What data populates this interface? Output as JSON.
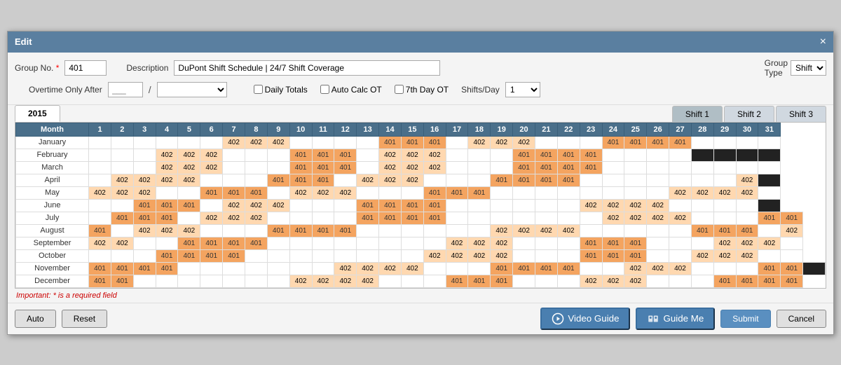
{
  "dialog": {
    "title": "Edit",
    "close_label": "×"
  },
  "form": {
    "group_no_label": "Group No.",
    "group_no_value": "401",
    "description_label": "Description",
    "description_value": "DuPont Shift Schedule | 24/7 Shift Coverage",
    "overtime_label": "Overtime Only After",
    "overtime_value": "",
    "overtime_placeholder": "___",
    "daily_totals_label": "Daily Totals",
    "auto_calc_label": "Auto Calc OT",
    "seventh_day_label": "7th Day OT",
    "shifts_day_label": "Shifts/Day",
    "shifts_day_value": "1",
    "group_type_label": "Group Type",
    "group_type_value": "Shift"
  },
  "tabs": {
    "year_tab": "2015",
    "shift_tabs": [
      "Shift 1",
      "Shift 2",
      "Shift 3"
    ]
  },
  "calendar": {
    "header": [
      "Month",
      "1",
      "2",
      "3",
      "4",
      "5",
      "6",
      "7",
      "8",
      "9",
      "10",
      "11",
      "12",
      "13",
      "14",
      "15",
      "16",
      "17",
      "18",
      "19",
      "20",
      "21",
      "22",
      "23",
      "24",
      "25",
      "26",
      "27",
      "28",
      "29",
      "30",
      "31"
    ],
    "rows": [
      {
        "month": "January",
        "cells": [
          "",
          "",
          "",
          "",
          "",
          "",
          "402",
          "402",
          "402",
          "",
          "",
          "",
          "",
          "401",
          "401",
          "401",
          "",
          "402",
          "402",
          "402",
          "",
          "",
          "",
          "401",
          "401",
          "401",
          "401",
          "",
          "",
          "",
          ""
        ]
      },
      {
        "month": "February",
        "cells": [
          "",
          "",
          "",
          "402",
          "402",
          "402",
          "",
          "",
          "",
          "401",
          "401",
          "401",
          "",
          "402",
          "402",
          "402",
          "",
          "",
          "",
          "401",
          "401",
          "401",
          "401",
          "",
          "",
          "",
          "",
          "black",
          "black",
          "black",
          "black"
        ]
      },
      {
        "month": "March",
        "cells": [
          "",
          "",
          "",
          "402",
          "402",
          "402",
          "",
          "",
          "",
          "401",
          "401",
          "401",
          "",
          "402",
          "402",
          "402",
          "",
          "",
          "",
          "401",
          "401",
          "401",
          "401",
          "",
          "",
          "",
          "",
          "",
          "",
          "",
          ""
        ]
      },
      {
        "month": "April",
        "cells": [
          "",
          "402",
          "402",
          "402",
          "402",
          "",
          "",
          "",
          "401",
          "401",
          "401",
          "",
          "402",
          "402",
          "402",
          "",
          "",
          "",
          "401",
          "401",
          "401",
          "401",
          "",
          "",
          "",
          "",
          "",
          "",
          "",
          "402",
          "black"
        ]
      },
      {
        "month": "May",
        "cells": [
          "402",
          "402",
          "402",
          "",
          "",
          "401",
          "401",
          "401",
          "",
          "402",
          "402",
          "402",
          "",
          "",
          "",
          "401",
          "401",
          "401",
          "",
          "",
          "",
          "",
          "",
          "",
          "",
          "",
          "402",
          "402",
          "402",
          "402",
          ""
        ]
      },
      {
        "month": "June",
        "cells": [
          "",
          "",
          "401",
          "401",
          "401",
          "",
          "402",
          "402",
          "402",
          "",
          "",
          "",
          "401",
          "401",
          "401",
          "401",
          "",
          "",
          "",
          "",
          "",
          "",
          "402",
          "402",
          "402",
          "402",
          "",
          "",
          "",
          "",
          "black"
        ]
      },
      {
        "month": "July",
        "cells": [
          "",
          "401",
          "401",
          "401",
          "",
          "402",
          "402",
          "402",
          "",
          "",
          "",
          "",
          "401",
          "401",
          "401",
          "401",
          "",
          "",
          "",
          "",
          "",
          "",
          "",
          "402",
          "402",
          "402",
          "402",
          "",
          "",
          "",
          "401",
          "401"
        ]
      },
      {
        "month": "August",
        "cells": [
          "401",
          "",
          "402",
          "402",
          "402",
          "",
          "",
          "",
          "401",
          "401",
          "401",
          "401",
          "",
          "",
          "",
          "",
          "",
          "",
          "402",
          "402",
          "402",
          "402",
          "",
          "",
          "",
          "",
          "",
          "401",
          "401",
          "401",
          "",
          "402"
        ]
      },
      {
        "month": "September",
        "cells": [
          "402",
          "402",
          "",
          "",
          "401",
          "401",
          "401",
          "401",
          "",
          "",
          "",
          "",
          "",
          "",
          "",
          "",
          "402",
          "402",
          "402",
          "",
          "",
          "",
          "401",
          "401",
          "401",
          "",
          "",
          "",
          "402",
          "402",
          "402",
          ""
        ]
      },
      {
        "month": "October",
        "cells": [
          "",
          "",
          "",
          "401",
          "401",
          "401",
          "401",
          "",
          "",
          "",
          "",
          "",
          "",
          "",
          "",
          "402",
          "402",
          "402",
          "402",
          "",
          "",
          "",
          "401",
          "401",
          "401",
          "",
          "",
          "402",
          "402",
          "402",
          "",
          ""
        ]
      },
      {
        "month": "November",
        "cells": [
          "401",
          "401",
          "401",
          "401",
          "",
          "",
          "",
          "",
          "",
          "",
          "",
          "402",
          "402",
          "402",
          "402",
          "",
          "",
          "",
          "401",
          "401",
          "401",
          "401",
          "",
          "",
          "402",
          "402",
          "402",
          "",
          "",
          "",
          "401",
          "401",
          "black"
        ]
      },
      {
        "month": "December",
        "cells": [
          "401",
          "401",
          "",
          "",
          "",
          "",
          "",
          "",
          "",
          "402",
          "402",
          "402",
          "402",
          "",
          "",
          "",
          "401",
          "401",
          "401",
          "",
          "",
          "",
          "402",
          "402",
          "402",
          "",
          "",
          "",
          "401",
          "401",
          "401",
          "401"
        ]
      }
    ]
  },
  "footer": {
    "note": "Important: * is a required field",
    "auto_btn": "Auto",
    "reset_btn": "Reset",
    "video_guide_btn": "Video Guide",
    "guide_me_btn": "Guide Me",
    "submit_btn": "Submit",
    "cancel_btn": "Cancel"
  }
}
